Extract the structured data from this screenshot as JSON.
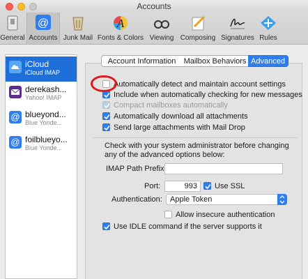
{
  "window": {
    "title": "Accounts"
  },
  "toolbar": {
    "items": [
      {
        "label": "General"
      },
      {
        "label": "Accounts"
      },
      {
        "label": "Junk Mail"
      },
      {
        "label": "Fonts & Colors"
      },
      {
        "label": "Viewing"
      },
      {
        "label": "Composing"
      },
      {
        "label": "Signatures"
      },
      {
        "label": "Rules"
      }
    ]
  },
  "accounts": [
    {
      "name": "iCloud",
      "sub": "iCloud IMAP",
      "icon": "cloud-icon",
      "color": "#4a9cf5"
    },
    {
      "name": "derekash...",
      "sub": "Yahoo! IMAP",
      "icon": "envelope-icon",
      "color": "#5b2d8e"
    },
    {
      "name": "blueyond...",
      "sub": "Blue Yonde...",
      "icon": "at-sign-icon",
      "color": "#2f7ef0"
    },
    {
      "name": "foilblueyo...",
      "sub": "Blue Yonde...",
      "icon": "at-sign-icon",
      "color": "#2f7ef0"
    }
  ],
  "tabs": [
    {
      "label": "Account Information"
    },
    {
      "label": "Mailbox Behaviors"
    },
    {
      "label": "Advanced"
    }
  ],
  "options": {
    "auto_detect": "Automatically detect and maintain account settings",
    "include_check": "Include when automatically checking for new messages",
    "compact": "Compact mailboxes automatically",
    "download_attachments": "Automatically download all attachments",
    "mail_drop": "Send large attachments with Mail Drop"
  },
  "advanced": {
    "note": "Check with your system administrator before changing any of the advanced options below:",
    "imap_prefix_label": "IMAP Path Prefix:",
    "imap_prefix_value": "",
    "port_label": "Port:",
    "port_value": "993",
    "use_ssl": "Use SSL",
    "auth_label": "Authentication:",
    "auth_value": "Apple Token",
    "insecure_auth": "Allow insecure authentication",
    "idle": "Use IDLE command if the server supports it"
  },
  "colors": {
    "accent": "#2f7ef0",
    "highlight": "#e0191c"
  }
}
